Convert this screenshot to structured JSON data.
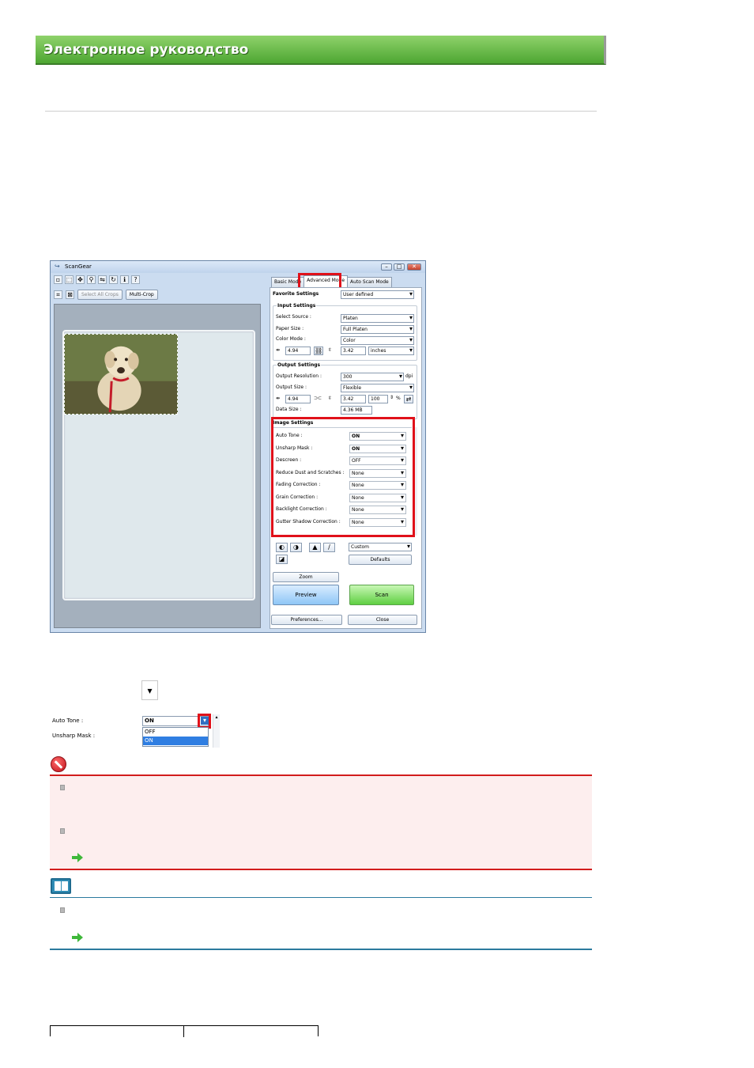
{
  "header": {
    "title": "Электронное руководство"
  },
  "window": {
    "title": "ScanGear",
    "toolbar2": {
      "select_all_crops": "Select All Crops",
      "multi_crop": "Multi-Crop"
    },
    "tabs": [
      "Basic Mode",
      "Advanced Mode",
      "Auto Scan Mode"
    ],
    "favorite_settings": {
      "label": "Favorite Settings",
      "value": "User defined"
    },
    "input_settings": {
      "heading": "Input Settings",
      "select_source": {
        "label": "Select Source :",
        "value": "Platen"
      },
      "paper_size": {
        "label": "Paper Size :",
        "value": "Full Platen"
      },
      "color_mode": {
        "label": "Color Mode :",
        "value": "Color"
      },
      "width": "4.94",
      "height": "3.42",
      "unit": "inches"
    },
    "output_settings": {
      "heading": "Output Settings",
      "resolution": {
        "label": "Output Resolution :",
        "value": "300",
        "unit": "dpi"
      },
      "output_size": {
        "label": "Output Size :",
        "value": "Flexible"
      },
      "width": "4.94",
      "height": "3.42",
      "scale": "100",
      "scale_unit": "%",
      "data_size": {
        "label": "Data Size :",
        "value": "4.36 MB"
      }
    },
    "image_settings": {
      "heading": "Image Settings",
      "rows": [
        {
          "label": "Auto Tone :",
          "value": "ON"
        },
        {
          "label": "Unsharp Mask :",
          "value": "ON"
        },
        {
          "label": "Descreen :",
          "value": "OFF"
        },
        {
          "label": "Reduce Dust and Scratches :",
          "value": "None"
        },
        {
          "label": "Fading Correction :",
          "value": "None"
        },
        {
          "label": "Grain Correction :",
          "value": "None"
        },
        {
          "label": "Backlight Correction :",
          "value": "None"
        },
        {
          "label": "Gutter Shadow Correction :",
          "value": "None"
        }
      ]
    },
    "adjust": {
      "preset": "Custom",
      "defaults": "Defaults"
    },
    "zoom": "Zoom",
    "preview": "Preview",
    "scan": "Scan",
    "preferences": "Preferences...",
    "close": "Close"
  },
  "snippet": {
    "row1_label": "Auto Tone :",
    "row2_label": "Unsharp Mask :",
    "current": "ON",
    "options": [
      "OFF",
      "ON"
    ]
  },
  "colors": {
    "banner": "#5fb43d",
    "warning": "#d21c1c",
    "note": "#2b7a9e",
    "highlight": "#e0111a"
  }
}
